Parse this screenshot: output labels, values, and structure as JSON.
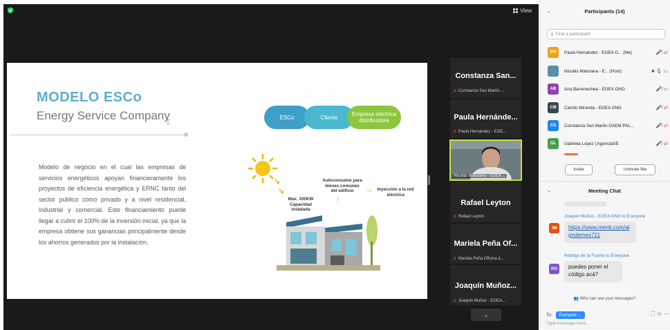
{
  "meeting": {
    "view_label": "View",
    "security_icon": "shield-icon"
  },
  "slide": {
    "title": "MODELO ESCo",
    "subtitle": "Energy Service Company",
    "body": "Modelo de negocio en el cual las empresas de servicios energéticos apoyan financieramente los proyectos de eficiencia energética y ERNC tanto del sector público como privado y a nivel residencial, industrial y comercial. Este financiamiento puede llegar a cubrir el 100% de la inversión inicial, ya que la empresa obtiene sus ganancias principalmente desde los ahorros generados por la instalación.",
    "flow": [
      "ESCo",
      "Cliente",
      "Empresa eléctrica distribuidora"
    ],
    "labels": {
      "max": "Max. 100KW Capacidad instalada",
      "auto": "Autoconsumo para bienes comunes del edificio",
      "inye": "Inyección a la red eléctrica"
    },
    "colors": {
      "title": "#5aaed1",
      "flow1": "#3ea0c8",
      "flow2": "#4cb8d0",
      "flow3": "#8cc63e",
      "arrow": "#f5a81c"
    }
  },
  "gallery": {
    "tiles": [
      {
        "name": "Constanza San...",
        "sub": "Constanza San Martín ..."
      },
      {
        "name": "Paula Hernánde...",
        "sub": "Paula Hernández - EGE..."
      },
      {
        "video_label": "Nicolás Maturana - EGEA ..."
      },
      {
        "name": "Rafael Leyton",
        "sub": "Rafael Leyton"
      },
      {
        "name": "Mariela Peña Of...",
        "sub": "Mariela Peña Oficina d..."
      },
      {
        "name": "Joaquín Muñoz...",
        "sub": "Joaquín Muñoz - EGEA..."
      }
    ]
  },
  "participants": {
    "title": "Participants (14)",
    "search_placeholder": "Find a participant",
    "list": [
      {
        "initials": "PH",
        "color": "#f0a020",
        "name": "Paula Hernández - EGEA O...",
        "tag": "(Me)"
      },
      {
        "initials": "",
        "color": "#5b8fa6",
        "name": "Nicolás Maturana - E...",
        "tag": "(Host)"
      },
      {
        "initials": "AB",
        "color": "#8e44ad",
        "name": "Ana Barrenechea - EGEA ONG",
        "tag": ""
      },
      {
        "initials": "CM",
        "color": "#37474f",
        "name": "Camilo Miranda - EGEA ONG",
        "tag": ""
      },
      {
        "initials": "CS",
        "color": "#1e88e5",
        "name": "Constanza San Martín DAEM PAL...",
        "tag": ""
      },
      {
        "initials": "GL",
        "color": "#43a047",
        "name": "Gabriela López | AgenciaSE",
        "tag": ""
      }
    ],
    "invite_label": "Invite",
    "unmute_label": "Unmute Me"
  },
  "chat": {
    "title": "Meeting Chat",
    "messages": [
      {
        "initials": "JM",
        "color": "#e65100",
        "sender": "Joaquín Muñoz - EGEA ONG to Everyone",
        "text": "https://www.menti.com/algndemes721"
      },
      {
        "initials": "RO",
        "color": "#7e57c2",
        "sender": "Rodrigo de la Fuente to Everyone",
        "text": "puedes poner el código acá?"
      }
    ],
    "who_can_see": "Who can see your messages?",
    "to_label": "To:",
    "to_value": "Everyone",
    "input_placeholder": "Type message here..."
  }
}
